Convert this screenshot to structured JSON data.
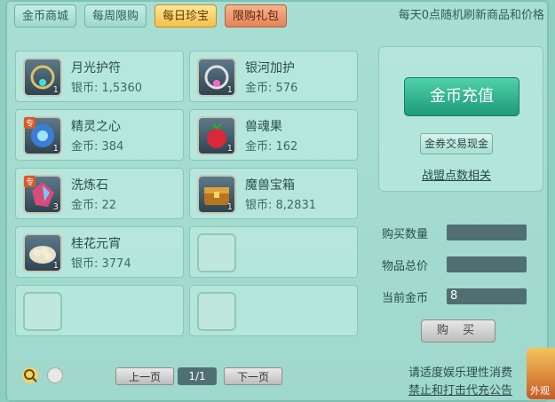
{
  "tabs": [
    {
      "label": "金币商城"
    },
    {
      "label": "每周限购"
    },
    {
      "label": "每日珍宝"
    },
    {
      "label": "限购礼包"
    }
  ],
  "notice": "每天0点随机刷新商品和价格",
  "items": [
    {
      "name": "月光护符",
      "price": "银币: 1,5360",
      "qty": "1"
    },
    {
      "name": "银河加护",
      "price": "金币: 576",
      "qty": "1"
    },
    {
      "name": "精灵之心",
      "price": "金币: 384",
      "qty": "1",
      "tag": "专"
    },
    {
      "name": "兽魂果",
      "price": "金币: 162",
      "qty": "1"
    },
    {
      "name": "洗炼石",
      "price": "金币: 22",
      "qty": "3",
      "tag": "专"
    },
    {
      "name": "魔兽宝箱",
      "price": "银币: 8,2831",
      "qty": "1"
    },
    {
      "name": "桂花元宵",
      "price": "银币: 3774",
      "qty": "1"
    }
  ],
  "right": {
    "recharge": "金币充值",
    "exchange": "金券交易现金",
    "league": "战盟点数相关"
  },
  "purchase": {
    "qty_label": "购买数量",
    "total_label": "物品总价",
    "gold_label": "当前金币",
    "gold_value": "8",
    "buy": "购 买"
  },
  "pager": {
    "prev": "上一页",
    "page": "1/1",
    "next": "下一页"
  },
  "footer": {
    "line1": "请适度娱乐理性消费",
    "line2": "禁止和打击代充公告"
  },
  "corner_text": "外观"
}
